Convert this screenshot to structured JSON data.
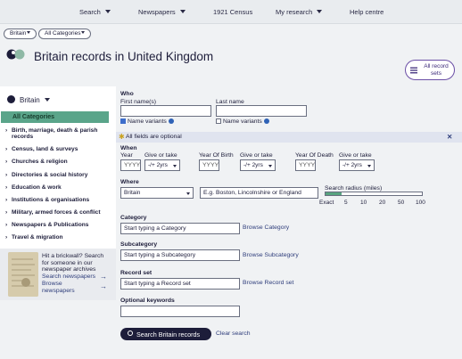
{
  "topnav": {
    "items": [
      "Search",
      "Newspapers",
      "1921 Census",
      "My research",
      "Help centre"
    ]
  },
  "filters": {
    "region": "Britain",
    "category": "All Categories"
  },
  "page": {
    "title": "Britain records in United Kingdom",
    "all_records_label": "All record sets"
  },
  "sidebar": {
    "region": "Britain",
    "all_categories": "All Categories",
    "categories": [
      "Birth, marriage, death & parish records",
      "Census, land & surveys",
      "Churches & religion",
      "Directories & social history",
      "Education & work",
      "Institutions & organisations",
      "Military, armed forces & conflict",
      "Newspapers & Publications",
      "Travel & migration"
    ],
    "promo": {
      "text": "Hit a brickwall? Search for someone in our newspaper archives",
      "search_link": "Search newspapers",
      "browse_link": "Browse newspapers"
    }
  },
  "form": {
    "who": "Who",
    "first_name_label": "First name(s)",
    "last_name_label": "Last name",
    "name_variants": "Name variants",
    "optional_note": "All fields are optional",
    "when": "When",
    "year_label": "Year",
    "give_or_take_label": "Give or take",
    "year_of_birth_label": "Year Of Birth",
    "year_of_death_label": "Year Of Death",
    "year_placeholder": "YYYY",
    "range_value": "-/+ 2yrs",
    "where": "Where",
    "where_value": "Britain",
    "where_placeholder": "E.g. Boston, Lincolnshire or England",
    "radius_label": "Search radius (miles)",
    "radius_ticks": [
      "Exact",
      "5",
      "10",
      "20",
      "50",
      "100"
    ],
    "radius_level_fraction": 0.17,
    "category_label": "Category",
    "category_placeholder": "Start typing a Category",
    "browse_category": "Browse Category",
    "subcategory_label": "Subcategory",
    "subcategory_placeholder": "Start typing a Subcategory",
    "browse_subcategory": "Browse Subcategory",
    "recordset_label": "Record set",
    "recordset_placeholder": "Start typing a Record set",
    "browse_recordset": "Browse Record set",
    "keywords_label": "Optional keywords",
    "search_button": "Search Britain records",
    "clear_link": "Clear search"
  }
}
